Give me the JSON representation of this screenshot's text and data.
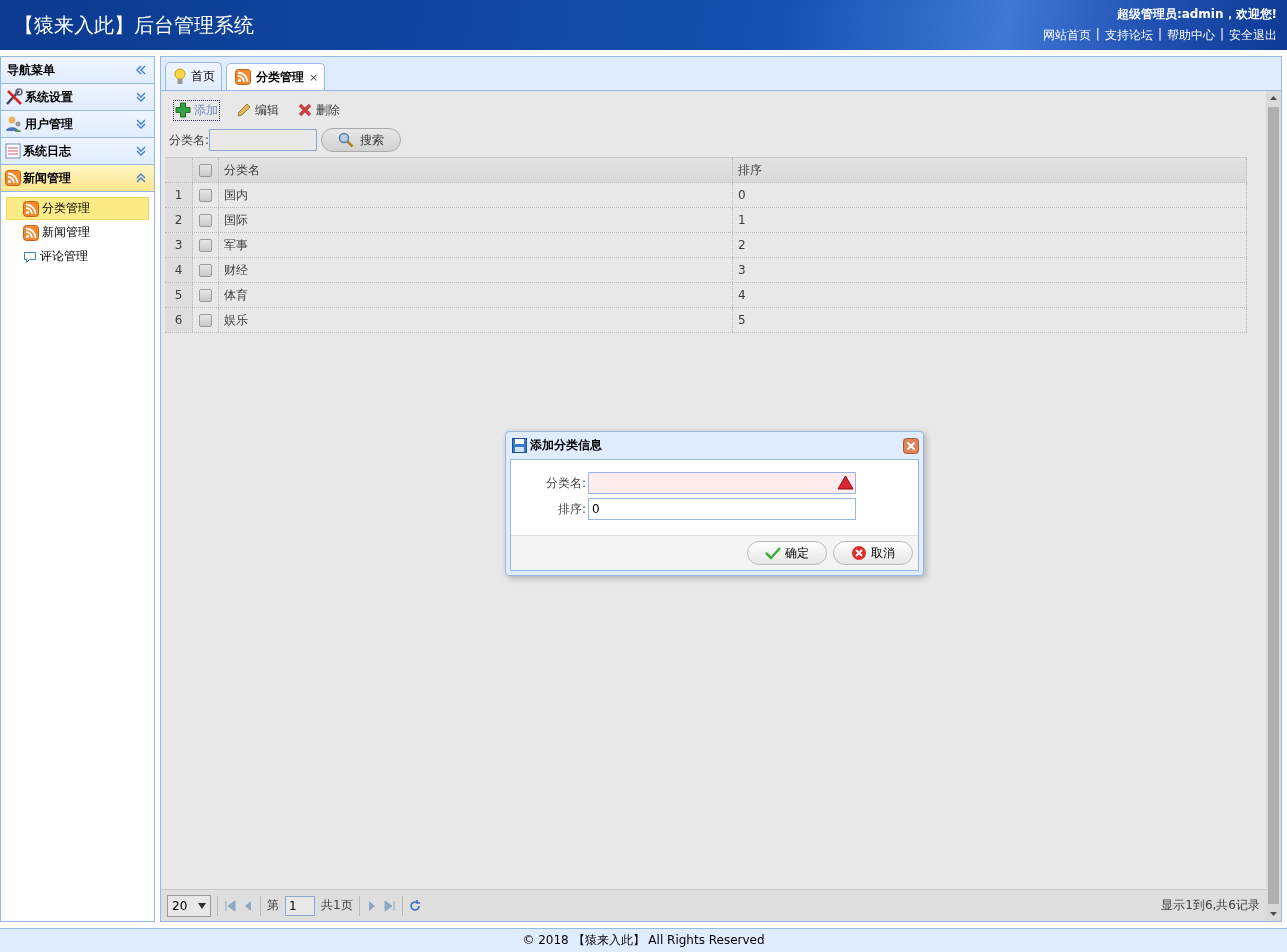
{
  "header": {
    "title": "【猿来入此】后台管理系统",
    "welcome": "超级管理员:admin，欢迎您!",
    "link_separator": "|",
    "links": [
      "网站首页",
      "支持论坛",
      "帮助中心",
      "安全退出"
    ]
  },
  "sidebar": {
    "title": "导航菜单",
    "sections": [
      {
        "label": "系统设置",
        "expanded": false
      },
      {
        "label": "用户管理",
        "expanded": false
      },
      {
        "label": "系统日志",
        "expanded": false
      },
      {
        "label": "新闻管理",
        "expanded": true,
        "items": [
          {
            "label": "分类管理",
            "selected": true
          },
          {
            "label": "新闻管理",
            "selected": false
          },
          {
            "label": "评论管理",
            "selected": false
          }
        ]
      }
    ]
  },
  "tabs": [
    {
      "label": "首页",
      "selected": false
    },
    {
      "label": "分类管理",
      "selected": true,
      "close": "×"
    }
  ],
  "toolbar": [
    {
      "label": "添加",
      "focused": true
    },
    {
      "label": "编辑",
      "focused": false
    },
    {
      "label": "删除",
      "focused": false
    }
  ],
  "search": {
    "label": "分类名:",
    "button": "搜索"
  },
  "table": {
    "columns": [
      "分类名",
      "排序"
    ],
    "all_checked": false,
    "rows": [
      {
        "index": "1",
        "checked": false,
        "cells": [
          "国内",
          "0"
        ]
      },
      {
        "index": "2",
        "checked": false,
        "cells": [
          "国际",
          "1"
        ]
      },
      {
        "index": "3",
        "checked": false,
        "cells": [
          "军事",
          "2"
        ]
      },
      {
        "index": "4",
        "checked": false,
        "cells": [
          "财经",
          "3"
        ]
      },
      {
        "index": "5",
        "checked": false,
        "cells": [
          "体育",
          "4"
        ]
      },
      {
        "index": "6",
        "checked": false,
        "cells": [
          "娱乐",
          "5"
        ]
      }
    ]
  },
  "pager": {
    "page_size": "20",
    "page_prefix": "第",
    "page": "1",
    "page_total": "共1页",
    "summary": "显示1到6,共6记录"
  },
  "dialog": {
    "title": "添加分类信息",
    "fields": [
      {
        "label": "分类名:",
        "invalid": true
      },
      {
        "label": "排序:",
        "value": "0",
        "invalid": false
      }
    ],
    "buttons": [
      {
        "label": "确定",
        "kind": "ok"
      },
      {
        "label": "取消",
        "kind": "cancel"
      }
    ]
  },
  "footer": "© 2018 【猿来入此】 All Rights Reserved"
}
